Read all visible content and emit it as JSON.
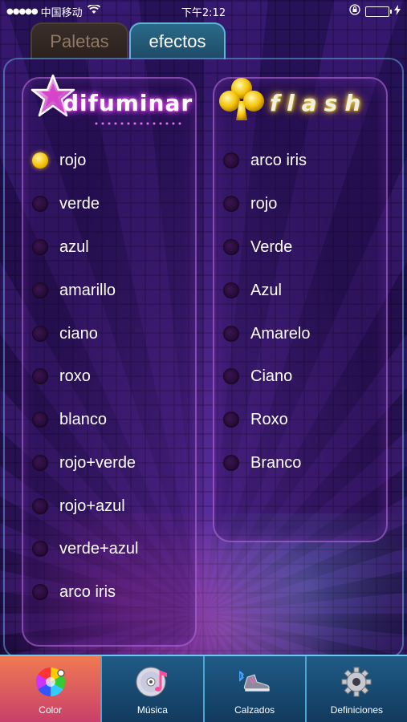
{
  "status_bar": {
    "signal": "●●●●●",
    "carrier": "中国移动",
    "time": "下午2:12"
  },
  "tabs": [
    {
      "label": "Paletas",
      "active": false
    },
    {
      "label": "efectos",
      "active": true
    }
  ],
  "left_column": {
    "title": "difuminar",
    "icon": "star-icon",
    "options": [
      {
        "label": "rojo",
        "selected": true
      },
      {
        "label": "verde",
        "selected": false
      },
      {
        "label": "azul",
        "selected": false
      },
      {
        "label": "amarillo",
        "selected": false
      },
      {
        "label": "ciano",
        "selected": false
      },
      {
        "label": "roxo",
        "selected": false
      },
      {
        "label": "blanco",
        "selected": false
      },
      {
        "label": "rojo+verde",
        "selected": false
      },
      {
        "label": "rojo+azul",
        "selected": false
      },
      {
        "label": "verde+azul",
        "selected": false
      },
      {
        "label": "arco iris",
        "selected": false
      }
    ]
  },
  "right_column": {
    "title": "flash",
    "icon": "club-icon",
    "options": [
      {
        "label": "arco iris",
        "selected": false
      },
      {
        "label": "rojo",
        "selected": false
      },
      {
        "label": "Verde",
        "selected": false
      },
      {
        "label": "Azul",
        "selected": false
      },
      {
        "label": "Amarelo",
        "selected": false
      },
      {
        "label": "Ciano",
        "selected": false
      },
      {
        "label": "Roxo",
        "selected": false
      },
      {
        "label": "Branco",
        "selected": false
      }
    ]
  },
  "nav": [
    {
      "label": "Color",
      "icon": "color-wheel-icon",
      "active": true
    },
    {
      "label": "Música",
      "icon": "music-cd-icon",
      "active": false
    },
    {
      "label": "Calzados",
      "icon": "shoe-bluetooth-icon",
      "active": false
    },
    {
      "label": "Definiciones",
      "icon": "gear-icon",
      "active": false
    }
  ],
  "colors": {
    "accent_active_tab": "#2b6a8a",
    "nav_active": "#e0605e",
    "radio_selected": "#f5c400"
  }
}
